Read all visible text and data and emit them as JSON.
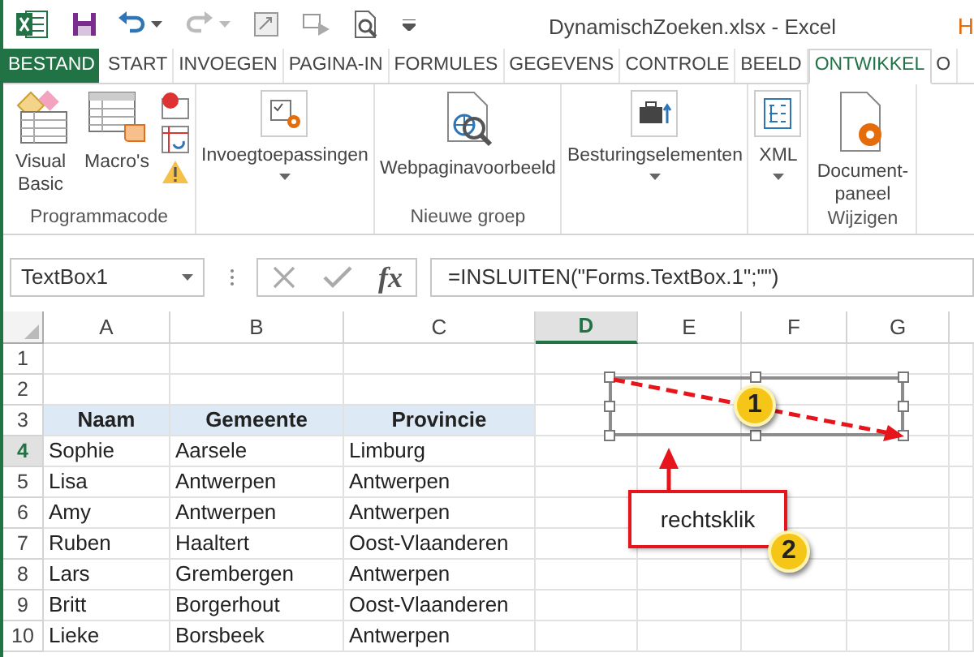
{
  "window": {
    "title": "DynamischZoeken.xlsx - Excel",
    "edge_text": "H"
  },
  "tabs": [
    {
      "label": "BESTAND",
      "kind": "file",
      "selected": false
    },
    {
      "label": "START",
      "kind": "tab",
      "selected": false
    },
    {
      "label": "INVOEGEN",
      "kind": "tab",
      "selected": false
    },
    {
      "label": "PAGINA-IN",
      "kind": "tab",
      "selected": false
    },
    {
      "label": "FORMULES",
      "kind": "tab",
      "selected": false
    },
    {
      "label": "GEGEVENS",
      "kind": "tab",
      "selected": false
    },
    {
      "label": "CONTROLE",
      "kind": "tab",
      "selected": false
    },
    {
      "label": "BEELD",
      "kind": "tab",
      "selected": false
    },
    {
      "label": "ONTWIKKEL",
      "kind": "tab",
      "selected": true
    },
    {
      "label": "O",
      "kind": "tab",
      "selected": false
    }
  ],
  "ribbon": {
    "groups": [
      {
        "label": "Programmacode",
        "items": [
          {
            "label": "Visual Basic",
            "kind": "vb"
          },
          {
            "label": "Macro's",
            "kind": "macro"
          },
          {
            "kind": "small-stack"
          }
        ]
      },
      {
        "items": [
          {
            "label": "Invoegtoepassingen",
            "kind": "addins",
            "dropdown": true
          }
        ]
      },
      {
        "label": "Nieuwe groep",
        "items": [
          {
            "label": "Webpaginavoorbeeld",
            "kind": "webpreview",
            "dropdown": false
          }
        ]
      },
      {
        "items": [
          {
            "label": "Besturingselementen",
            "kind": "controls",
            "dropdown": true
          }
        ]
      },
      {
        "items": [
          {
            "label": "XML",
            "kind": "xml",
            "dropdown": true
          }
        ]
      },
      {
        "label": "Wijzigen",
        "items": [
          {
            "label": "Document-paneel",
            "kind": "docpanel",
            "dropdown": false
          }
        ]
      }
    ]
  },
  "formula_bar": {
    "name_box": "TextBox1",
    "function_label": "fx",
    "formula": "=INSLUITEN(\"Forms.TextBox.1\";\"\")"
  },
  "sheet": {
    "columns": [
      {
        "label": "A",
        "selected": false
      },
      {
        "label": "B",
        "selected": false
      },
      {
        "label": "C",
        "selected": false
      },
      {
        "label": "D",
        "selected": true
      },
      {
        "label": "E",
        "selected": false
      },
      {
        "label": "F",
        "selected": false
      },
      {
        "label": "G",
        "selected": false
      }
    ],
    "rows": [
      {
        "number": "1",
        "selected": false,
        "kind": "plain",
        "cells": []
      },
      {
        "number": "2",
        "selected": false,
        "kind": "plain",
        "cells": []
      },
      {
        "number": "3",
        "selected": false,
        "kind": "header",
        "cells": [
          "Naam",
          "Gemeente",
          "Provincie"
        ]
      },
      {
        "number": "4",
        "selected": true,
        "kind": "plain",
        "cells": [
          "Sophie",
          "Aarsele",
          "Limburg"
        ]
      },
      {
        "number": "5",
        "selected": false,
        "kind": "plain",
        "cells": [
          "Lisa",
          "Antwerpen",
          "Antwerpen"
        ]
      },
      {
        "number": "6",
        "selected": false,
        "kind": "plain",
        "cells": [
          "Amy",
          "Antwerpen",
          "Antwerpen"
        ]
      },
      {
        "number": "7",
        "selected": false,
        "kind": "plain",
        "cells": [
          "Ruben",
          "Haaltert",
          "Oost-Vlaanderen"
        ]
      },
      {
        "number": "8",
        "selected": false,
        "kind": "plain",
        "cells": [
          "Lars",
          "Grembergen",
          "Antwerpen"
        ]
      },
      {
        "number": "9",
        "selected": false,
        "kind": "plain",
        "cells": [
          "Britt",
          "Borgerhout",
          "Oost-Vlaanderen"
        ]
      },
      {
        "number": "10",
        "selected": false,
        "kind": "plain",
        "cells": [
          "Lieke",
          "Borsbeek",
          "Antwerpen"
        ]
      }
    ]
  },
  "annotations": {
    "steps": [
      {
        "label": "1"
      },
      {
        "label": "2"
      }
    ],
    "callout": "rechtsklik"
  }
}
